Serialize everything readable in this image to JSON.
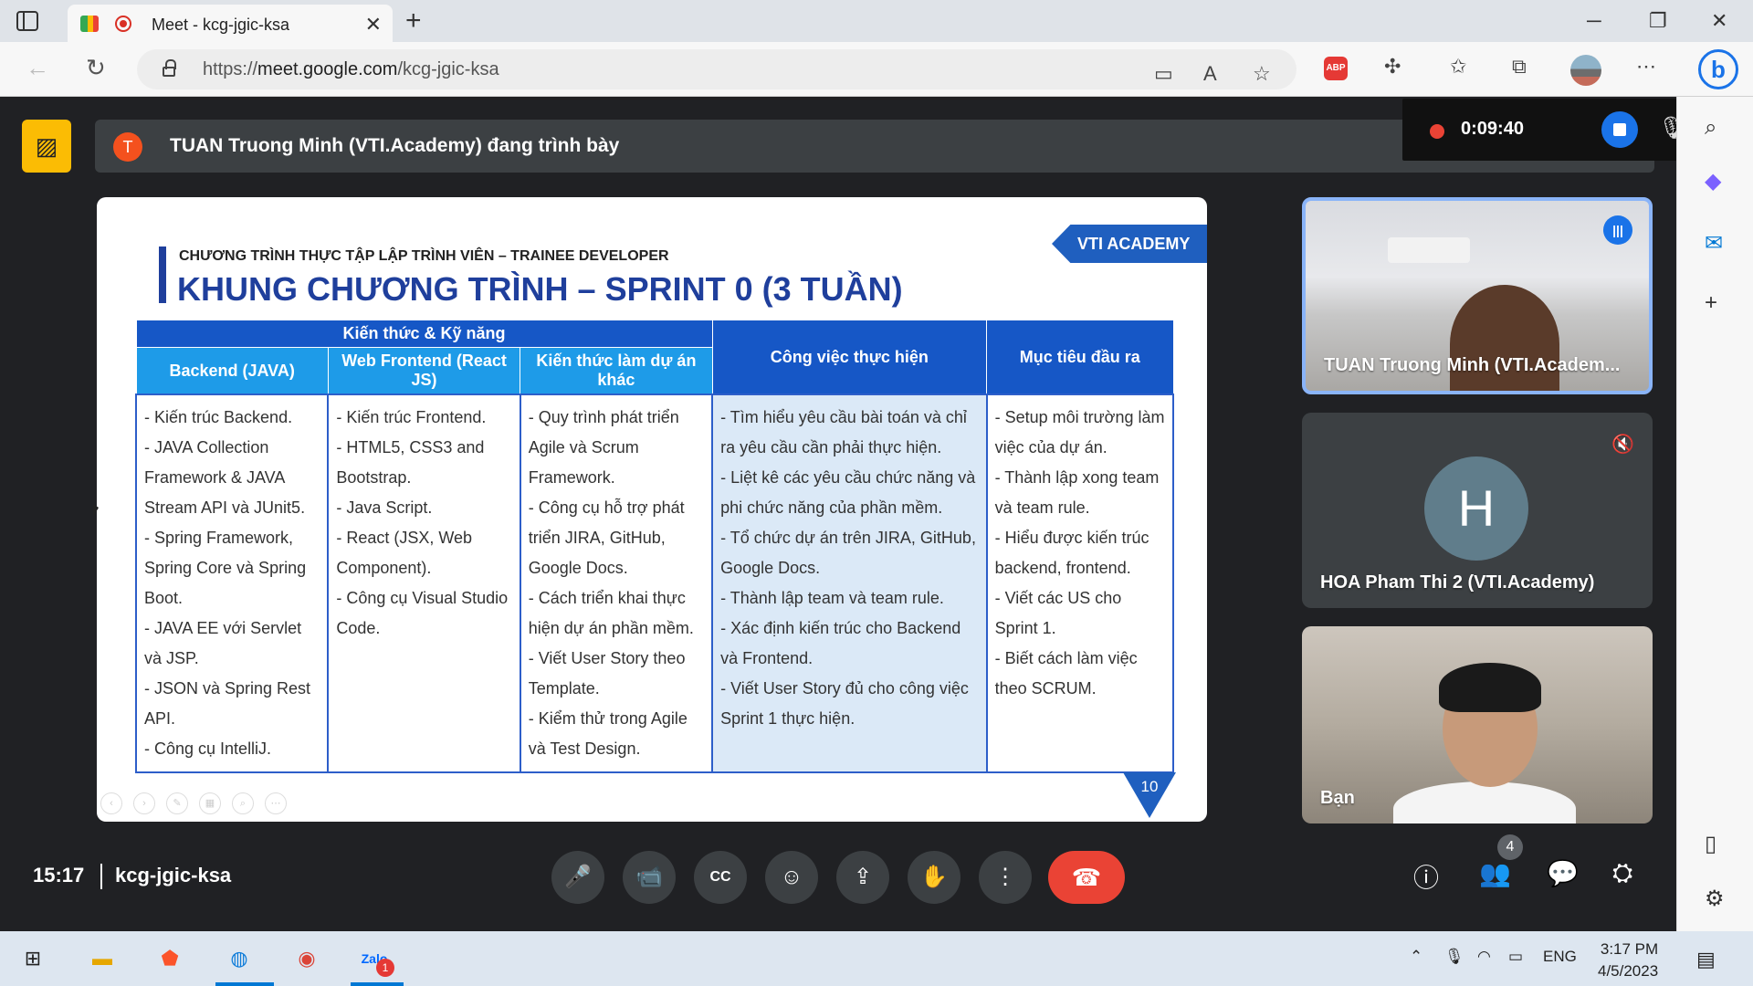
{
  "browser": {
    "tab_title": "Meet - kcg-jgic-ksa",
    "url_prefix": "https://",
    "url_domain": "meet.google.com",
    "url_path": "/kcg-jgic-ksa",
    "abp_label": "ABP"
  },
  "meet": {
    "presenter_initial": "T",
    "presenter_text": "TUAN Truong Minh (VTI.Academy) đang trình bày",
    "recording_time": "0:09:40",
    "clock": "15:17",
    "meeting_code": "kcg-jgic-ksa",
    "participants_count": "4",
    "accent_blue": "#1a73e8",
    "hangup_red": "#ea4335"
  },
  "slide": {
    "subtitle": "CHƯƠNG TRÌNH THỰC TẬP LẬP TRÌNH VIÊN – TRAINEE DEVELOPER",
    "title": "KHUNG CHƯƠNG TRÌNH – SPRINT 0 (3 TUẦN)",
    "logo": "VTI ACADEMY",
    "page_number": "10",
    "header_group": "Kiến thức & Kỹ năng",
    "columns": [
      "Backend (JAVA)",
      "Web Frontend (React JS)",
      "Kiến thức làm dự án khác",
      "Công việc thực hiện",
      "Mục tiêu đầu ra"
    ],
    "cells": [
      "- Kiến trúc Backend.\n- JAVA Collection Framework & JAVA Stream API và JUnit5.\n- Spring Framework, Spring Core và Spring Boot.\n- JAVA EE với Servlet và JSP.\n- JSON và Spring Rest API.\n- Công cụ IntelliJ.",
      "- Kiến trúc Frontend.\n- HTML5, CSS3 and Bootstrap.\n- Java Script.\n- React (JSX, Web Component).\n- Công cụ Visual Studio Code.",
      "- Quy trình phát triển Agile và Scrum Framework.\n- Công cụ hỗ trợ phát triển JIRA, GitHub, Google Docs.\n- Cách triển khai thực hiện dự án phần mềm.\n- Viết User Story theo Template.\n- Kiểm thử trong Agile và Test Design.",
      "- Tìm hiểu yêu cầu bài toán và chỉ ra yêu cầu cần phải thực hiện.\n- Liệt kê các yêu cầu chức năng và phi chức năng của phần mềm.\n- Tổ chức dự án trên JIRA, GitHub, Google Docs.\n- Thành lập team và team rule.\n- Xác định kiến trúc cho Backend và Frontend.\n- Viết User Story đủ cho công việc Sprint 1 thực hiện.",
      "- Setup môi trường làm việc của dự án.\n- Thành lập xong team và team rule.\n- Hiểu được kiến trúc backend, frontend.\n- Viết các US cho Sprint 1.\n- Biết cách làm việc theo SCRUM."
    ]
  },
  "participants": [
    {
      "name": "TUAN Truong Minh (VTI.Academ...",
      "state": "speaking"
    },
    {
      "name": "HOA Pham Thi 2 (VTI.Academy)",
      "initial": "H",
      "state": "muted"
    },
    {
      "name": "Bạn",
      "state": "self-video"
    }
  ],
  "taskbar": {
    "lang": "ENG",
    "time": "3:17 PM",
    "date": "4/5/2023",
    "zalo_badge": "1"
  }
}
